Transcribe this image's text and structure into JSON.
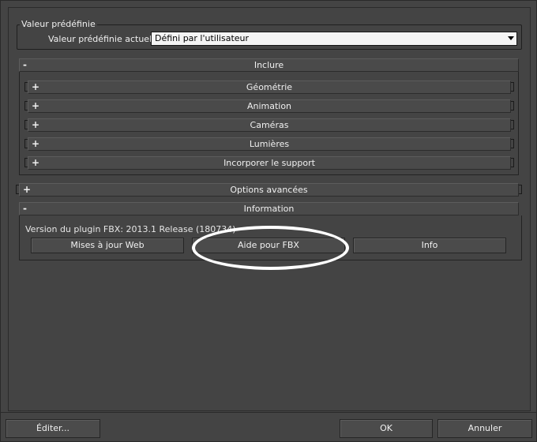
{
  "preset": {
    "group_title": "Valeur prédéfinie",
    "current_label": "Valeur prédéfinie actuelle:",
    "current_value": "Défini par l'utilisateur"
  },
  "include": {
    "sign": "-",
    "title": "Inclure",
    "items": [
      {
        "sign": "+",
        "label": "Géométrie"
      },
      {
        "sign": "+",
        "label": "Animation"
      },
      {
        "sign": "+",
        "label": "Caméras"
      },
      {
        "sign": "+",
        "label": "Lumières"
      },
      {
        "sign": "+",
        "label": "Incorporer le support"
      }
    ]
  },
  "advanced": {
    "sign": "+",
    "title": "Options avancées"
  },
  "information": {
    "sign": "-",
    "title": "Information",
    "version_text": "Version du plugin FBX: 2013.1 Release (180734)",
    "buttons": {
      "web_updates": "Mises à jour Web",
      "fbx_help": "Aide pour FBX",
      "info": "Info"
    }
  },
  "footer": {
    "edit": "Éditer...",
    "ok": "OK",
    "cancel": "Annuler"
  },
  "annotation_color": "#ffffff"
}
